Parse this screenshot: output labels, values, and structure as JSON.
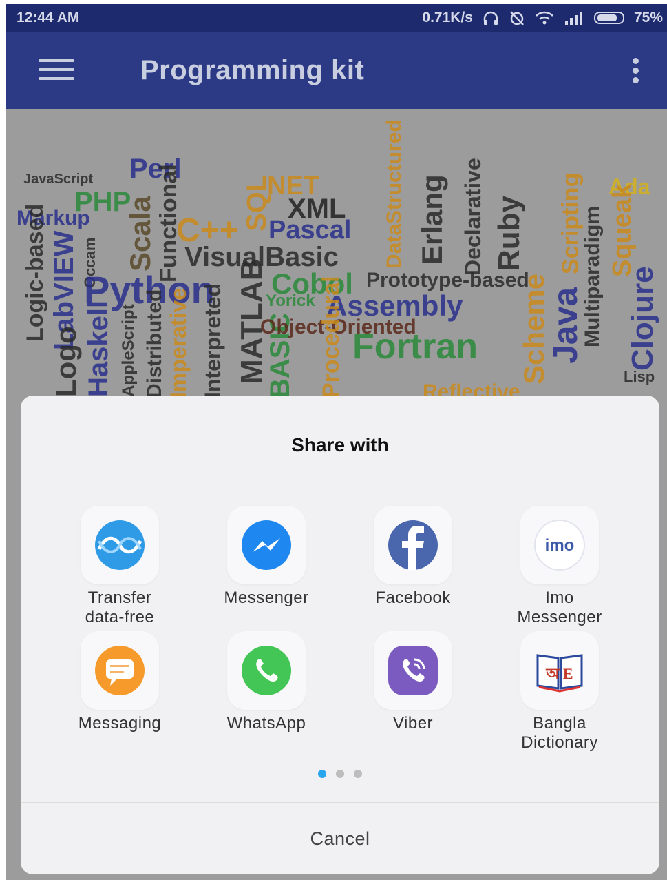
{
  "status_bar": {
    "time": "12:44 AM",
    "speed": "0.71K/s",
    "battery": "75%"
  },
  "app_bar": {
    "title": "Programming kit"
  },
  "word_cloud": {
    "words": [
      "JavaScript",
      "Perl",
      "PHP",
      "NET",
      "XML",
      "Markup",
      "Scala",
      "Functional",
      "C++",
      "SQL",
      "Pascal",
      "DataStructured",
      "Erlang",
      "Declarative",
      "Ruby",
      "Scripting",
      "Multiparadigm",
      "Ada",
      "Squeak",
      "Logic-based",
      "LabVIEW",
      "Occam",
      "Python",
      "VisualBasic",
      "Cobol",
      "Prototype-based",
      "MATLAB",
      "Yorick",
      "Assembly",
      "Scheme",
      "Java",
      "Clojure",
      "Logo",
      "Haskell",
      "AppleScript",
      "Distributed",
      "Imperative",
      "Interpreted",
      "BASIC",
      "Object-Oriented",
      "Fortran",
      "Procedural",
      "Reflective",
      "Lisp"
    ]
  },
  "share_sheet": {
    "title": "Share with",
    "apps": [
      {
        "label": "Transfer\ndata-free",
        "icon": "transfer-icon"
      },
      {
        "label": "Messenger",
        "icon": "messenger-icon"
      },
      {
        "label": "Facebook",
        "icon": "facebook-icon"
      },
      {
        "label": "Imo\nMessenger",
        "icon": "imo-icon",
        "icon_text": "imo"
      },
      {
        "label": "Messaging",
        "icon": "messaging-icon"
      },
      {
        "label": "WhatsApp",
        "icon": "whatsapp-icon"
      },
      {
        "label": "Viber",
        "icon": "viber-icon"
      },
      {
        "label": "Bangla\nDictionary",
        "icon": "bangla-dictionary-icon",
        "icon_text": "অ E"
      }
    ],
    "page_indicator": {
      "pages": 3,
      "current": 1
    },
    "cancel_label": "Cancel"
  },
  "colors": {
    "status_bar": "#1d2a6e",
    "app_bar": "#2c3a85",
    "scrim": "#9c9c9c",
    "sheet": "#f1f1f3",
    "indicator_active": "#2aa6ef"
  }
}
